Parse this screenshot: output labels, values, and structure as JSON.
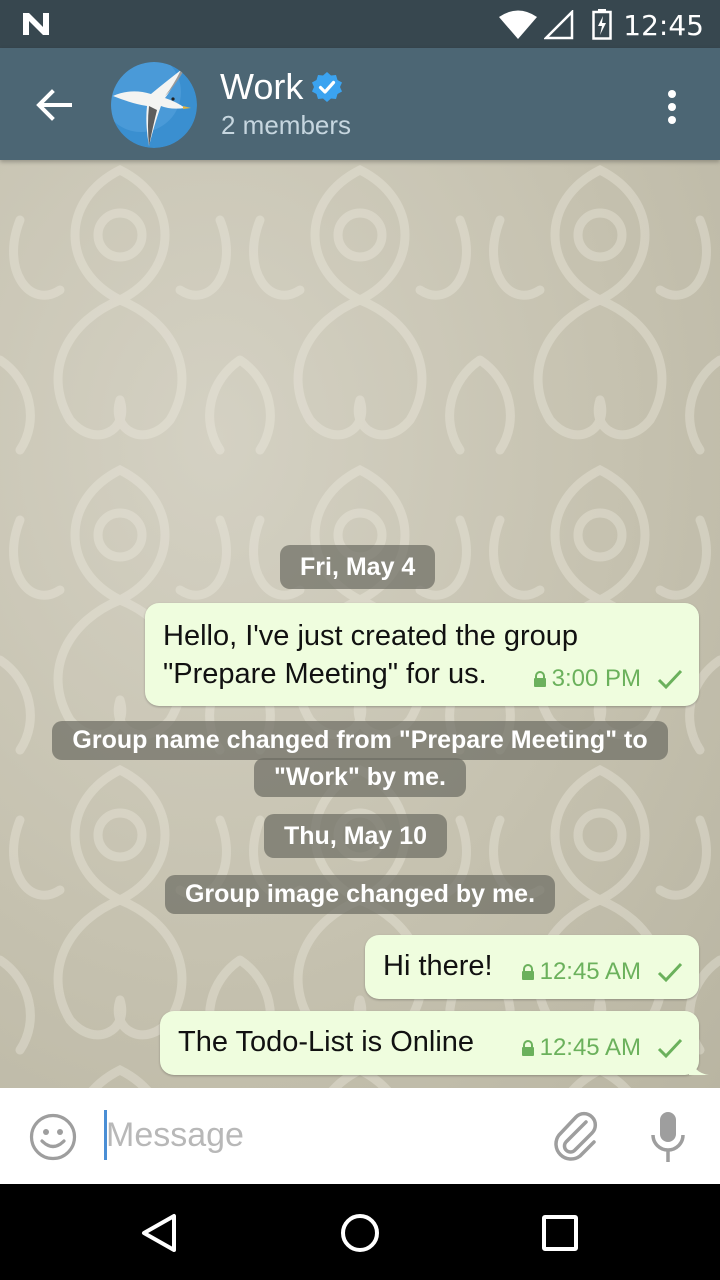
{
  "status_bar": {
    "time": "12:45"
  },
  "toolbar": {
    "title": "Work",
    "subtitle": "2 members"
  },
  "messages": [
    {
      "type": "date",
      "text": "Fri, May 4"
    },
    {
      "type": "outgoing",
      "lines": "Hello, I've just created the group\n\"Prepare Meeting\" for us.",
      "time": "3:00 PM"
    },
    {
      "type": "service",
      "line1": "Group name changed from \"Prepare Meeting\" to",
      "line2": "\"Work\" by me."
    },
    {
      "type": "date",
      "text": "Thu, May 10"
    },
    {
      "type": "service",
      "line1": "Group image changed by me."
    },
    {
      "type": "outgoing",
      "lines": "Hi there!",
      "time": "12:45 AM"
    },
    {
      "type": "outgoing",
      "lines": "The Todo-List is Online",
      "time": "12:45 AM"
    }
  ],
  "input": {
    "placeholder": "Message"
  },
  "colors": {
    "toolbar": "#4c6674",
    "status_bar": "#37474f",
    "bubble_out": "#effdde",
    "meta_green": "#6bb15c",
    "verified_blue": "#3ba3f0"
  },
  "icons": [
    "n-icon",
    "wifi-icon",
    "signal-icon",
    "battery-icon",
    "back-arrow-icon",
    "verified-icon",
    "more-vert-icon",
    "lock-icon",
    "check-icon",
    "emoji-icon",
    "paperclip-icon",
    "mic-icon",
    "nav-back-icon",
    "nav-home-icon",
    "nav-recents-icon"
  ]
}
